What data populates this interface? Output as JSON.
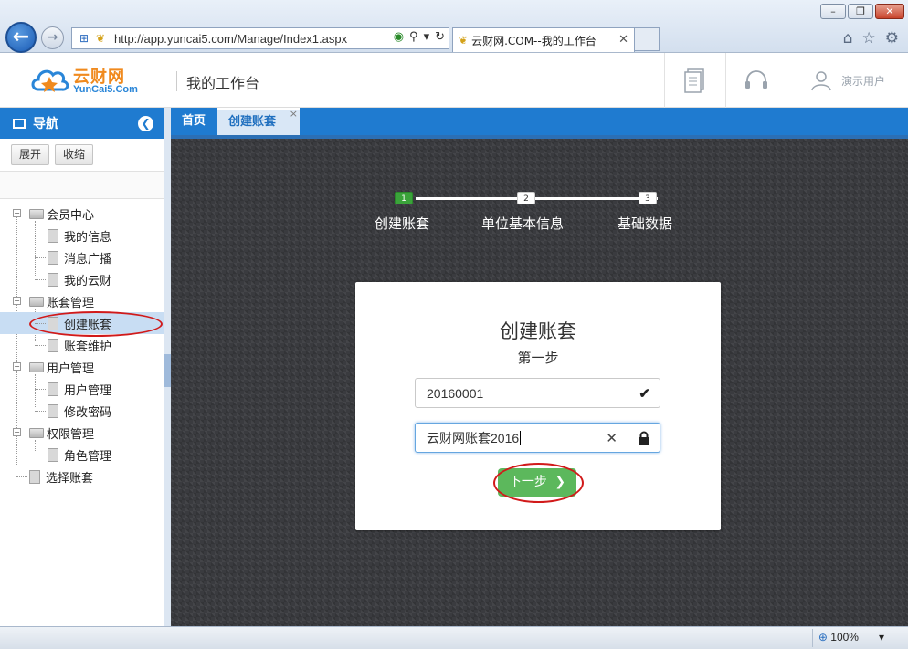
{
  "browser": {
    "url": "http://app.yuncai5.com/Manage/Index1.aspx",
    "tab_title": "云财网.COM--我的工作台",
    "zoom": "100%"
  },
  "header": {
    "logo_cn": "云财网",
    "logo_en": "YunCai5.Com",
    "title": "我的工作台",
    "user_label": "演示用户"
  },
  "sidebar": {
    "title": "导航",
    "expand_label": "展开",
    "collapse_label": "收缩",
    "tree": [
      {
        "label": "会员中心",
        "children": [
          "我的信息",
          "消息广播",
          "我的云财"
        ]
      },
      {
        "label": "账套管理",
        "children": [
          "创建账套",
          "账套维护"
        ]
      },
      {
        "label": "用户管理",
        "children": [
          "用户管理",
          "修改密码"
        ]
      },
      {
        "label": "权限管理",
        "children": [
          "角色管理"
        ]
      }
    ],
    "leaf": "选择账套",
    "selected": "创建账套"
  },
  "tabs": {
    "home": "首页",
    "active": "创建账套"
  },
  "wizard": {
    "steps": [
      {
        "num": "1",
        "label": "创建账套"
      },
      {
        "num": "2",
        "label": "单位基本信息"
      },
      {
        "num": "3",
        "label": "基础数据"
      }
    ],
    "current_step": 1
  },
  "card": {
    "title": "创建账套",
    "subtitle": "第一步",
    "code_value": "20160001",
    "name_value": "云财网账套2016",
    "next_label": "下一步"
  },
  "colors": {
    "primary": "#1f7bd0",
    "success": "#5cb85c",
    "highlight_ring": "#d11a1a"
  }
}
